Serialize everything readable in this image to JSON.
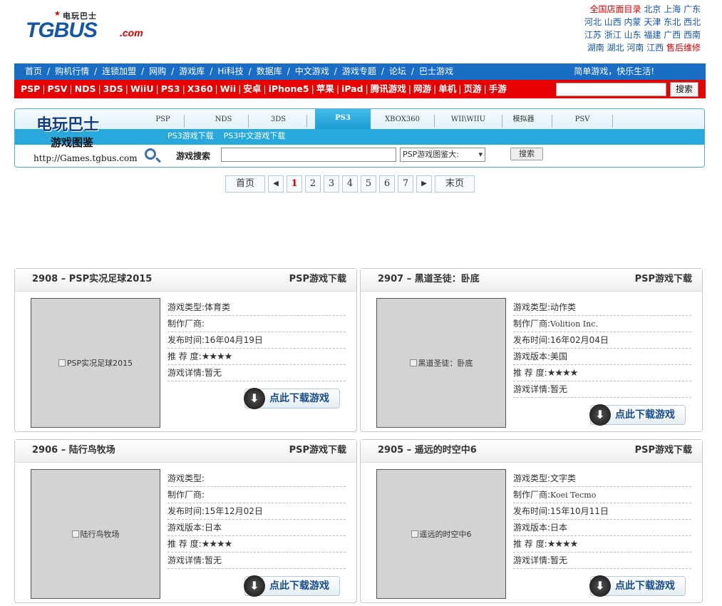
{
  "logo": {
    "cn": "电玩巴士",
    "main": "TGBUS",
    "suffix": ".com"
  },
  "cities": {
    "lines": [
      [
        {
          "t": "全国店面目录",
          "red": true
        },
        {
          "t": " 北京 上海 广东"
        }
      ],
      [
        {
          "t": "河北 山西 内蒙 天津 东北 西北"
        }
      ],
      [
        {
          "t": "江苏 浙江 山东 福建 广西 西南"
        }
      ],
      [
        {
          "t": "湖南 湖北 河南 江西 "
        },
        {
          "t": "售后维修",
          "red": true
        }
      ]
    ]
  },
  "nav_blue": {
    "items": [
      "首页",
      "购机行情",
      "连锁加盟",
      "网购",
      "游戏库",
      "Hi科技",
      "数据库",
      "中文游戏",
      "游戏专题",
      "论坛",
      "巴士游戏"
    ],
    "slogan": "简单游戏，快乐生活!"
  },
  "nav_red": {
    "items": [
      "PSP",
      "PSV",
      "NDS",
      "3DS",
      "WiiU",
      "PS3",
      "X360",
      "Wii",
      "安卓",
      "iPhone5",
      "苹果",
      "iPad",
      "腾讯游戏",
      "网游",
      "单机",
      "页游",
      "手游"
    ],
    "search_button": "搜索",
    "search_value": ""
  },
  "games_panel": {
    "logo_line1": "电玩巴士",
    "logo_line2": "游戏图鉴",
    "logo_url": "http://Games.tgbus.com",
    "tabs": [
      "PSP",
      "NDS",
      "3DS",
      "PS3",
      "XBOX360",
      "WII\\WIIU",
      "模拟器",
      "PSV"
    ],
    "active_tab": "PS3",
    "sublinks": [
      "PS3游戏下载",
      "PS3中文游戏下载"
    ],
    "search_label": "游戏搜索",
    "search_value": "",
    "select_value": "PSP游戏图鉴大:",
    "search_button": "搜索"
  },
  "pagination": {
    "first": "首页",
    "last": "末页",
    "pages": [
      "1",
      "2",
      "3",
      "4",
      "5",
      "6",
      "7"
    ],
    "current": "1",
    "prev": "◀",
    "next": "▶"
  },
  "cards": [
    {
      "title": "2908 – PSP实况足球2015",
      "category": "PSP游戏下载",
      "image_alt": "PSP实况足球2015",
      "rows": [
        {
          "k": "游戏类型:",
          "v": "体育类"
        },
        {
          "k": "制作厂商:",
          "v": ""
        },
        {
          "k": "发布时间:",
          "v": "16年04月19日"
        },
        {
          "k": "推 荐 度:",
          "v": "★★★★",
          "stars": true
        },
        {
          "k": "游戏详情:",
          "v": "暂无"
        }
      ],
      "button": "点此下载游戏"
    },
    {
      "title": "2907 – 黑道圣徒：卧底",
      "category": "PSP游戏下载",
      "image_alt": "黑道圣徒：卧底",
      "rows": [
        {
          "k": "游戏类型:",
          "v": "动作类"
        },
        {
          "k": "制作厂商:",
          "v": "Volition Inc.",
          "mono": true
        },
        {
          "k": "发布时间:",
          "v": "16年02月04日"
        },
        {
          "k": "游戏版本:",
          "v": "美国"
        },
        {
          "k": "推 荐 度:",
          "v": "★★★★",
          "stars": true
        },
        {
          "k": "游戏详情:",
          "v": "暂无"
        }
      ],
      "button": "点此下载游戏"
    },
    {
      "title": "2906 – 陆行鸟牧场",
      "category": "PSP游戏下载",
      "image_alt": "陆行鸟牧场",
      "rows": [
        {
          "k": "游戏类型:",
          "v": ""
        },
        {
          "k": "制作厂商:",
          "v": ""
        },
        {
          "k": "发布时间:",
          "v": "15年12月02日"
        },
        {
          "k": "游戏版本:",
          "v": "日本"
        },
        {
          "k": "推 荐 度:",
          "v": "★★★★",
          "stars": true
        },
        {
          "k": "游戏详情:",
          "v": "暂无"
        }
      ],
      "button": "点此下载游戏"
    },
    {
      "title": "2905 – 遥远的时空中6",
      "category": "PSP游戏下载",
      "image_alt": "遥远的时空中6",
      "rows": [
        {
          "k": "游戏类型:",
          "v": "文字类"
        },
        {
          "k": "制作厂商:",
          "v": "Koei Tecmo",
          "mono": true
        },
        {
          "k": "发布时间:",
          "v": "15年10月11日"
        },
        {
          "k": "游戏版本:",
          "v": "日本"
        },
        {
          "k": "推 荐 度:",
          "v": "★★★★",
          "stars": true
        },
        {
          "k": "游戏详情:",
          "v": "暂无"
        }
      ],
      "button": "点此下载游戏"
    }
  ],
  "colors": {
    "brand_blue": "#1656a8",
    "nav_blue": "#1a6dc4",
    "nav_red": "#e60000",
    "accent_cyan": "#29a8dc",
    "star_red": "#e02000"
  }
}
